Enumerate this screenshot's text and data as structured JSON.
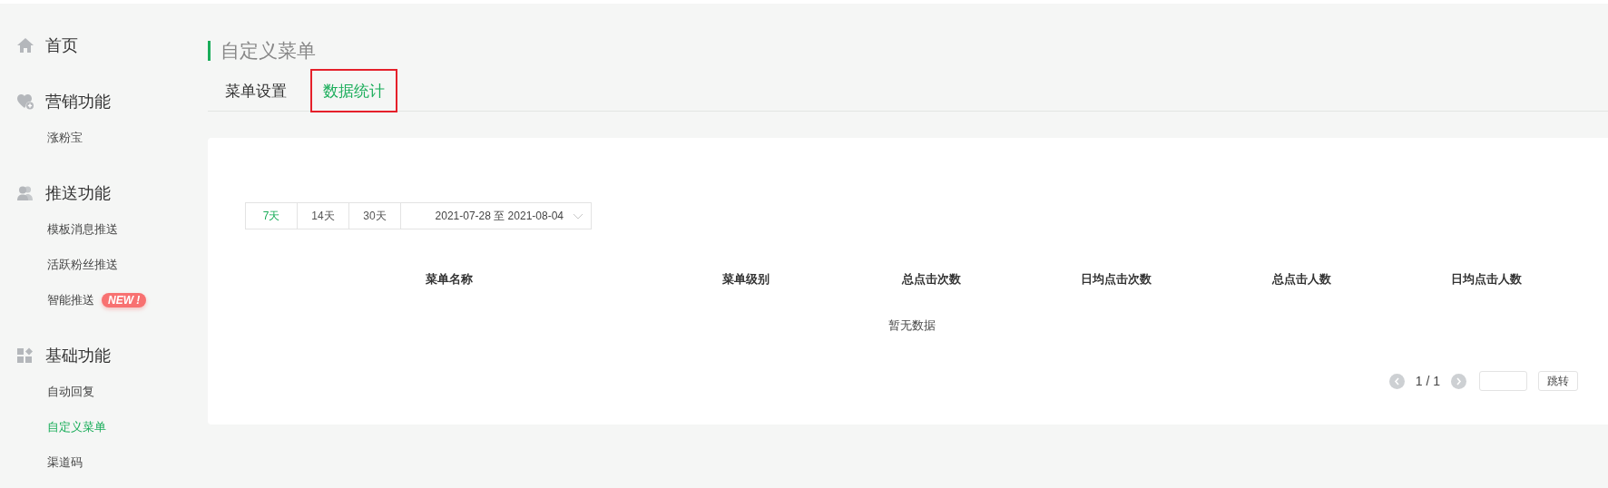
{
  "sidebar": {
    "sections": [
      {
        "label": "首页"
      },
      {
        "label": "营销功能",
        "items": [
          {
            "label": "涨粉宝",
            "selected": false
          }
        ]
      },
      {
        "label": "推送功能",
        "items": [
          {
            "label": "模板消息推送",
            "selected": false
          },
          {
            "label": "活跃粉丝推送",
            "selected": false
          },
          {
            "label": "智能推送",
            "selected": false,
            "badge": "NEW !"
          }
        ]
      },
      {
        "label": "基础功能",
        "items": [
          {
            "label": "自动回复",
            "selected": false
          },
          {
            "label": "自定义菜单",
            "selected": true
          },
          {
            "label": "渠道码",
            "selected": false
          }
        ]
      }
    ]
  },
  "page": {
    "title": "自定义菜单",
    "tabs": [
      {
        "label": "菜单设置",
        "selected": false,
        "highlighted": false
      },
      {
        "label": "数据统计",
        "selected": true,
        "highlighted": true
      }
    ]
  },
  "filter": {
    "ranges": [
      {
        "label": "7天",
        "selected": true
      },
      {
        "label": "14天",
        "selected": false
      },
      {
        "label": "30天",
        "selected": false
      }
    ],
    "date_range": "2021-07-28 至 2021-08-04"
  },
  "table": {
    "columns": [
      "菜单名称",
      "菜单级别",
      "总点击次数",
      "日均点击次数",
      "总点击人数",
      "日均点击人数"
    ],
    "empty_text": "暂无数据"
  },
  "pagination": {
    "page": "1 / 1",
    "jump_button": "跳转"
  }
}
